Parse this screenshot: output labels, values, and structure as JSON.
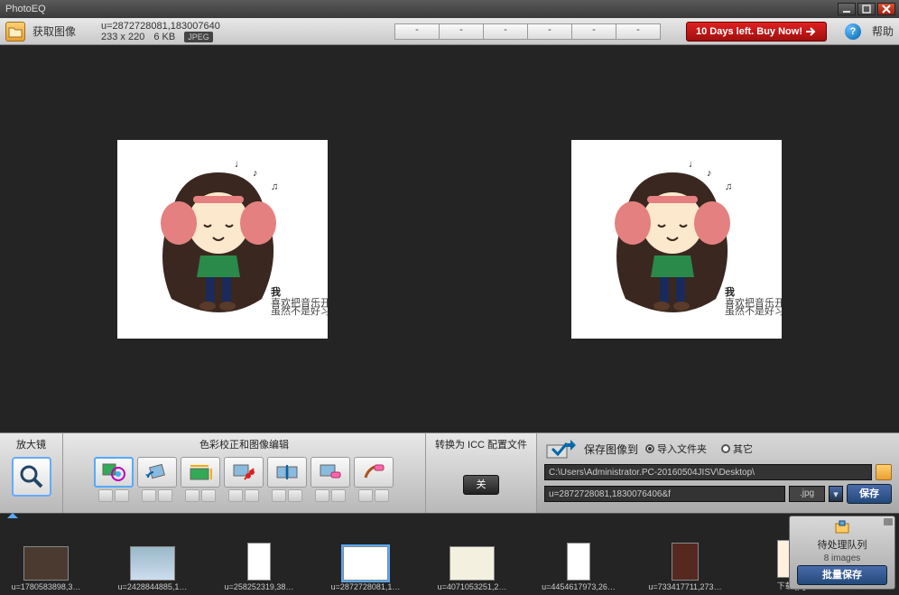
{
  "app": {
    "title": "PhotoEQ"
  },
  "toolbar": {
    "open_label": "获取图像",
    "info_line1": "u=2872728081,183007640",
    "info_dims": "233 x 220",
    "info_size": "6 KB",
    "info_format": "JPEG",
    "seg_labels": [
      "-",
      "-",
      "-",
      "-",
      "-",
      "-"
    ],
    "buy_label": "10 Days left. Buy Now!",
    "help_label": "帮助"
  },
  "controls": {
    "magnifier_label": "放大镜",
    "color_label": "色彩校正和图像编辑",
    "convert_label": "转换为 ICC 配置文件",
    "convert_btn": "关"
  },
  "save": {
    "save_to": "保存图像到",
    "radio_import": "导入文件夹",
    "radio_other": "其它",
    "path": "C:\\Users\\Administrator.PC-20160504JISV\\Desktop\\",
    "filename": "u=2872728081,1830076406&f",
    "ext": ".jpg",
    "save_btn": "保存"
  },
  "queue": {
    "title": "待处理队列",
    "count": "8 images",
    "batch_btn": "批量保存"
  },
  "filmstrip": [
    {
      "label": "u=1780583898,3…",
      "fill": "#4a3a30"
    },
    {
      "label": "u=2428844885,1…",
      "fill": "#9ab8c8"
    },
    {
      "label": "u=258252319,38…",
      "fill": "#ffffff"
    },
    {
      "label": "u=2872728081,1…",
      "fill": "#ffffff"
    },
    {
      "label": "u=4071053251,2…",
      "fill": "#f4f0e0"
    },
    {
      "label": "u=4454617973,26…",
      "fill": "#ffffff"
    },
    {
      "label": "u=733417711,273…",
      "fill": "#552820"
    },
    {
      "label": "下载.jpg",
      "fill": "#fff0e0"
    }
  ]
}
